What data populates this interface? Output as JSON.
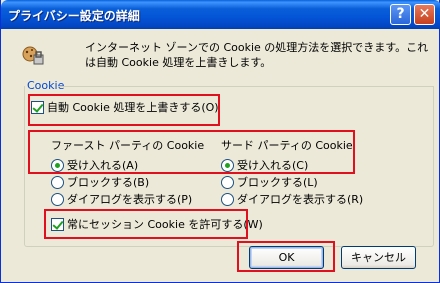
{
  "window": {
    "title": "プライバシー設定の詳細",
    "help_glyph": "?",
    "close_glyph": "✕"
  },
  "info": {
    "icon": "privacy-cookie-icon",
    "text": "インターネット ゾーンでの Cookie の処理方法を選択できます。これは自動 Cookie 処理を上書きします。"
  },
  "cookies": {
    "group_label": "Cookie",
    "override_label": "自動 Cookie 処理を上書きする(O)",
    "override_checked": true,
    "first_party": {
      "header": "ファースト パーティの Cookie",
      "options": [
        {
          "label": "受け入れる(A)",
          "selected": true
        },
        {
          "label": "ブロックする(B)",
          "selected": false
        },
        {
          "label": "ダイアログを表示する(P)",
          "selected": false
        }
      ]
    },
    "third_party": {
      "header": "サード パーティの Cookie",
      "options": [
        {
          "label": "受け入れる(C)",
          "selected": true
        },
        {
          "label": "ブロックする(L)",
          "selected": false
        },
        {
          "label": "ダイアログを表示する(R)",
          "selected": false
        }
      ]
    },
    "session_label": "常にセッション Cookie を許可する(W)",
    "session_checked": true
  },
  "buttons": {
    "ok": "OK",
    "cancel": "キャンセル"
  },
  "colors": {
    "highlight": "#e0101f",
    "title_bar": "#0454d7",
    "check_mark": "#21a121"
  }
}
